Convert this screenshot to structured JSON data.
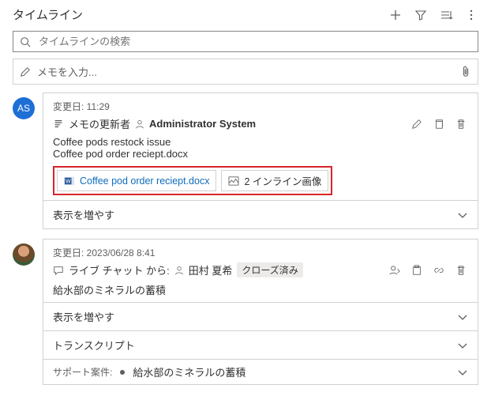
{
  "header": {
    "title": "タイムライン"
  },
  "search": {
    "placeholder": "タイムラインの検索"
  },
  "memo": {
    "placeholder": "メモを入力..."
  },
  "entries": [
    {
      "avatar_text": "AS",
      "meta": "変更日: 11:29",
      "prefix": "メモの更新者",
      "actor": "Administrator System",
      "body_line1": "Coffee pods restock issue",
      "body_line2": "Coffee pod order reciept.docx",
      "attachment_name": "Coffee pod order reciept.docx",
      "inline_images": "2 インライン画像",
      "show_more": "表示を増やす"
    },
    {
      "meta": "変更日: 2023/06/28 8:41",
      "prefix": "ライブ チャット から:",
      "actor": "田村 夏希",
      "status": "クローズ済み",
      "body_line1": "給水部のミネラルの蓄積",
      "show_more": "表示を増やす",
      "transcript": "トランスクリプト",
      "support_label": "サポート案件:",
      "support_value": "給水部のミネラルの蓄積"
    }
  ]
}
